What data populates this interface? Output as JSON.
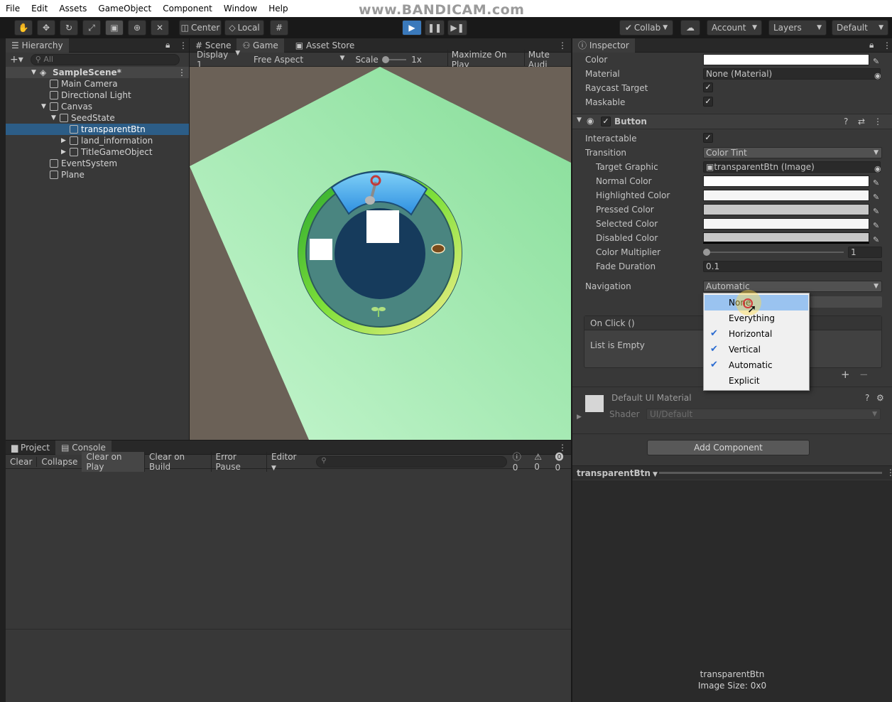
{
  "menubar": {
    "items": [
      "File",
      "Edit",
      "Assets",
      "GameObject",
      "Component",
      "Window",
      "Help"
    ],
    "watermark": "www.BANDICAM.com"
  },
  "toolbar": {
    "center_label": "Center",
    "local_label": "Local",
    "collab_label": "Collab",
    "account_label": "Account",
    "layers_label": "Layers",
    "layout_label": "Default"
  },
  "hierarchy": {
    "tab": "Hierarchy",
    "search_placeholder": "All",
    "scene": "SampleScene*",
    "items": [
      "Main Camera",
      "Directional Light",
      "Canvas",
      "SeedState",
      "transparentBtn",
      "land_information",
      "TitleGameObject",
      "EventSystem",
      "Plane"
    ]
  },
  "center_tabs": [
    "Scene",
    "Game",
    "Asset Store"
  ],
  "game_toolbar": {
    "display": "Display 1",
    "aspect": "Free Aspect",
    "scale_label": "Scale",
    "scale_value": "1x",
    "maximize": "Maximize On Play",
    "mute": "Mute Audi"
  },
  "bottom_tabs": [
    "Project",
    "Console"
  ],
  "console_toolbar": {
    "clear": "Clear",
    "collapse": "Collapse",
    "clear_on_play": "Clear on Play",
    "clear_on_build": "Clear on Build",
    "error_pause": "Error Pause",
    "editor": "Editor",
    "log_count": "0",
    "warn_count": "0",
    "error_count": "0"
  },
  "inspector": {
    "tab": "Inspector",
    "image_props": {
      "color_label": "Color",
      "material_label": "Material",
      "material_value": "None (Material)",
      "raycast_label": "Raycast Target",
      "maskable_label": "Maskable"
    },
    "button_component": {
      "title": "Button",
      "interactable_label": "Interactable",
      "transition_label": "Transition",
      "transition_value": "Color Tint",
      "target_graphic_label": "Target Graphic",
      "target_graphic_value": "transparentBtn (Image)",
      "normal_label": "Normal Color",
      "highlighted_label": "Highlighted Color",
      "pressed_label": "Pressed Color",
      "selected_label": "Selected Color",
      "disabled_label": "Disabled Color",
      "multiplier_label": "Color Multiplier",
      "multiplier_value": "1",
      "fade_label": "Fade Duration",
      "fade_value": "0.1",
      "navigation_label": "Navigation",
      "navigation_value": "Automatic",
      "onclick_label": "On Click ()",
      "list_empty": "List is Empty"
    },
    "navigation_options": [
      {
        "label": "None",
        "checked": false,
        "highlighted": true
      },
      {
        "label": "Everything",
        "checked": false,
        "highlighted": false
      },
      {
        "label": "Horizontal",
        "checked": true,
        "highlighted": false
      },
      {
        "label": "Vertical",
        "checked": true,
        "highlighted": false
      },
      {
        "label": "Automatic",
        "checked": true,
        "highlighted": false
      },
      {
        "label": "Explicit",
        "checked": false,
        "highlighted": false
      }
    ],
    "material": {
      "title": "Default UI Material",
      "shader_label": "Shader",
      "shader_value": "UI/Default"
    },
    "add_component": "Add Component",
    "preview_object": "transparentBtn",
    "preview_name": "transparentBtn",
    "preview_size": "Image Size: 0x0"
  },
  "colors": {
    "accent": "#3a79bb",
    "selection": "#2c5d87",
    "ground": "#8fe6a0",
    "ring_outer": "#5fcf3a",
    "ring_inner": "#4a8580",
    "center": "#163b5c"
  }
}
